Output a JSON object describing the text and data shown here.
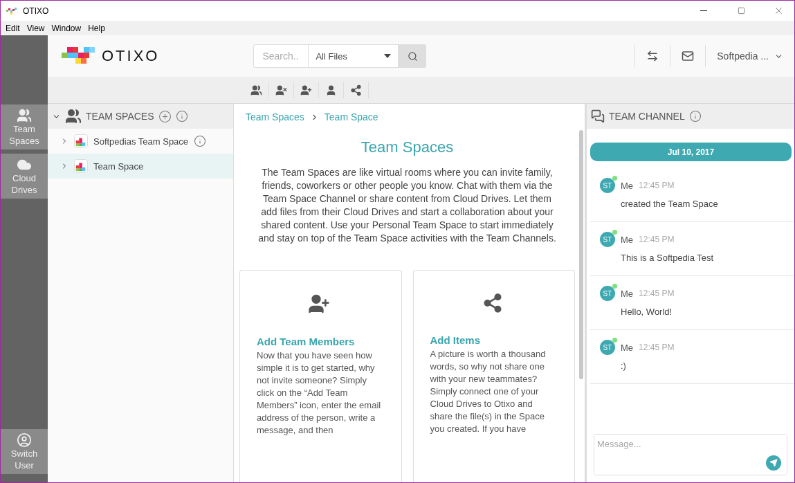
{
  "window": {
    "title": "OTIXO"
  },
  "menu": [
    "Edit",
    "View",
    "Window",
    "Help"
  ],
  "rail": [
    {
      "kind": "team",
      "label": "Team Spaces"
    },
    {
      "kind": "cloud",
      "label": "Cloud Drives"
    }
  ],
  "rail_bottom": {
    "label": "Switch User"
  },
  "header": {
    "logo_text": "OTIXO",
    "search": {
      "placeholder": "Search.."
    },
    "filter": {
      "value": "All Files"
    },
    "account": "Softpedia ..."
  },
  "toolbar": [
    {
      "kind": "edit-group"
    },
    {
      "kind": "remove-group"
    },
    {
      "kind": "add-user"
    },
    {
      "kind": "user"
    },
    {
      "kind": "share"
    }
  ],
  "tree": {
    "title": "TEAM SPACES",
    "items": [
      {
        "label": "Softpedias Team Space",
        "selected": false,
        "info": true
      },
      {
        "label": "Team Space",
        "selected": true,
        "info": false
      }
    ]
  },
  "breadcrumb": [
    "Team Spaces",
    "Team Space"
  ],
  "intro": {
    "title": "Team Spaces",
    "text": "The Team Spaces are like virtual rooms where you can invite family, friends, coworkers or other people you know. Chat with them via the Team Space Channel or share content from Cloud Drives. Let them add files from their Cloud Drives and start a collaboration about your shared content. Use your Personal Team Space to start immediately and stay on top of the Team Space activities with the Team Channels."
  },
  "cards": [
    {
      "kind": "add-user",
      "title": "Add Team Members",
      "text": "Now that you have seen how simple it is to get started, why not invite someone? Simply click on the “Add Team Members” icon, enter the email address of the person, write a message, and then"
    },
    {
      "kind": "share",
      "title": "Add Items",
      "text": "A picture is worth a thousand words, so why not share one with your new teammates? Simply connect one of your Cloud Drives to Otixo and share the file(s) in the Space you created. If you have"
    }
  ],
  "channel": {
    "title": "TEAM CHANNEL",
    "date": "Jul 10, 2017",
    "messages": [
      {
        "initials": "ST",
        "online": true,
        "author": "Me",
        "time": "12:45 PM",
        "text": "created the Team Space"
      },
      {
        "initials": "ST",
        "online": true,
        "author": "Me",
        "time": "12:45 PM",
        "text": "This is a Softpedia Test"
      },
      {
        "initials": "ST",
        "online": true,
        "author": "Me",
        "time": "12:45 PM",
        "text": "Hello, World!"
      },
      {
        "initials": "ST",
        "online": true,
        "author": "Me",
        "time": "12:45 PM",
        "text": ":)"
      }
    ],
    "input": {
      "placeholder": "Message..."
    }
  }
}
